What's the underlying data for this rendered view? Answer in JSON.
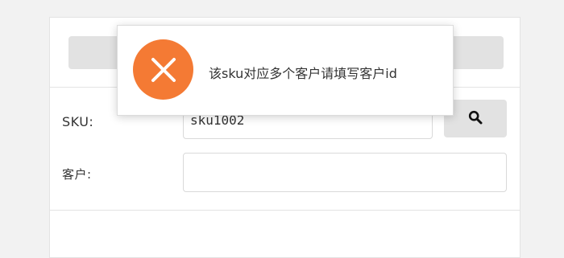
{
  "form": {
    "sku_label": "SKU:",
    "sku_value": "sku1002",
    "customer_label": "客户:",
    "customer_value": "",
    "search_icon": "search-icon"
  },
  "toast": {
    "type": "error",
    "icon": "close-icon",
    "message": "该sku对应多个客户请填写客户id",
    "accent_color": "#f47a34"
  }
}
